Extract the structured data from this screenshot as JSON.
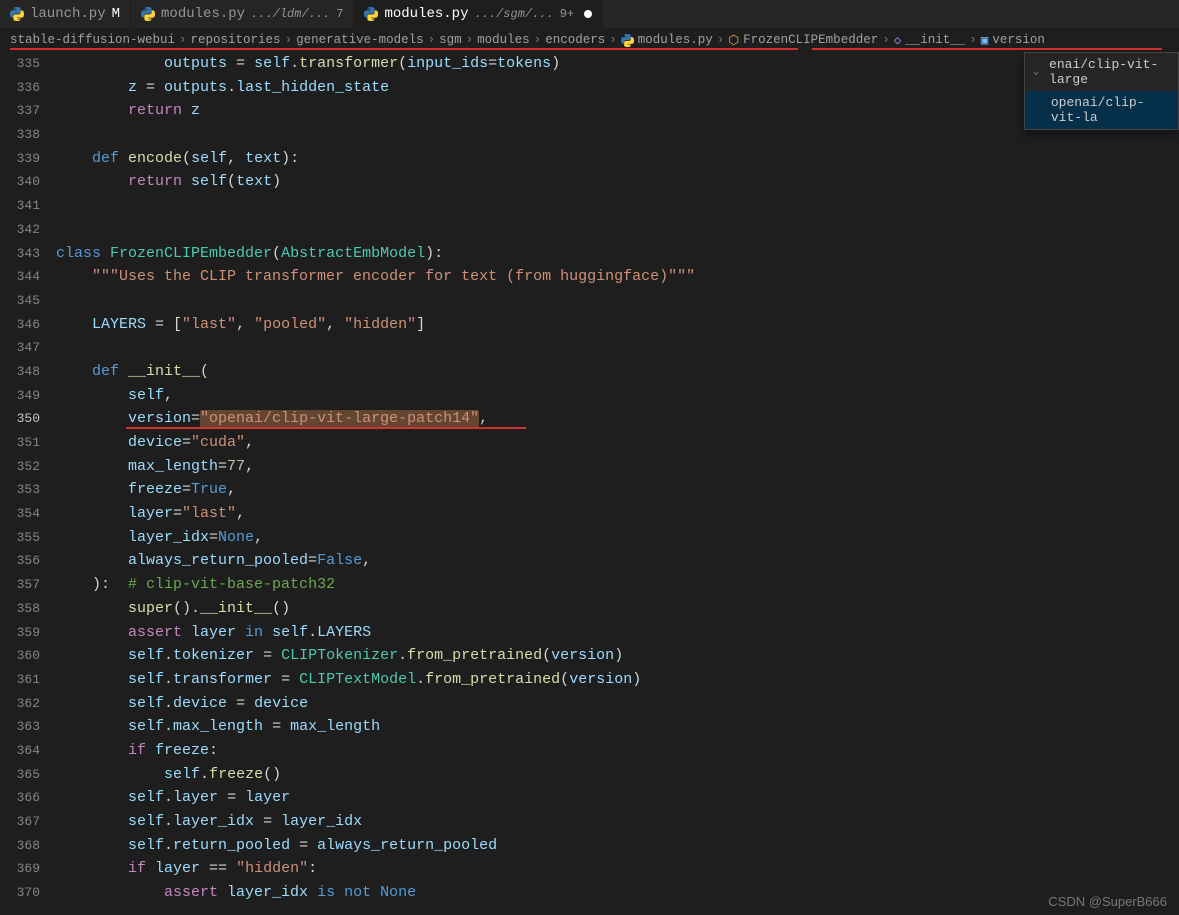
{
  "tabs": [
    {
      "name": "launch.py",
      "modifier": "M",
      "path": ""
    },
    {
      "name": "modules.py",
      "modifier": "7",
      "path": ".../ldm/..."
    },
    {
      "name": "modules.py",
      "modifier": "9+",
      "path": ".../sgm/...",
      "dirty": true
    }
  ],
  "breadcrumb": [
    "stable-diffusion-webui",
    "repositories",
    "generative-models",
    "sgm",
    "modules",
    "encoders",
    "modules.py",
    "FrozenCLIPEmbedder",
    "__init__",
    "version"
  ],
  "dropdown": {
    "line1": "enai/clip-vit-large",
    "line2": "openai/clip-vit-la"
  },
  "lines": {
    "start": 335,
    "end": 370,
    "active": 350
  },
  "code": {
    "335": {
      "outputs": "outputs",
      "eq": " = ",
      "self": "self",
      "dot": ".",
      "transformer": "transformer",
      "lp": "(",
      "input_ids": "input_ids",
      "eq2": "=",
      "tokens": "tokens",
      "rp": ")"
    },
    "336": {
      "z": "z",
      "eq": " = ",
      "outputs": "outputs",
      "dot": ".",
      "last_hidden_state": "last_hidden_state"
    },
    "337": {
      "return": "return",
      "z": " z"
    },
    "339": {
      "def": "def",
      "encode": " encode",
      "lp": "(",
      "self": "self",
      "c": ", ",
      "text": "text",
      "rp": "):"
    },
    "340": {
      "return": "return",
      "self": " self",
      "lp": "(",
      "text": "text",
      "rp": ")"
    },
    "343": {
      "class": "class",
      "name": " FrozenCLIPEmbedder",
      "lp": "(",
      "base": "AbstractEmbModel",
      "rp": "):"
    },
    "344": {
      "doc": "\"\"\"Uses the CLIP transformer encoder for text (from huggingface)\"\"\""
    },
    "346": {
      "layers": "LAYERS",
      "eq": " = [",
      "s1": "\"last\"",
      "c1": ", ",
      "s2": "\"pooled\"",
      "c2": ", ",
      "s3": "\"hidden\"",
      "rb": "]"
    },
    "348": {
      "def": "def",
      "init": " __init__",
      "lp": "("
    },
    "349": {
      "self": "self",
      "c": ","
    },
    "350": {
      "version": "version",
      "eq": "=",
      "val": "\"openai/clip-vit-large-patch14\"",
      "c": ","
    },
    "351": {
      "device": "device",
      "eq": "=",
      "val": "\"cuda\"",
      "c": ","
    },
    "352": {
      "max_length": "max_length",
      "eq": "=",
      "val": "77",
      "c": ","
    },
    "353": {
      "freeze": "freeze",
      "eq": "=",
      "val": "True",
      "c": ","
    },
    "354": {
      "layer": "layer",
      "eq": "=",
      "val": "\"last\"",
      "c": ","
    },
    "355": {
      "layer_idx": "layer_idx",
      "eq": "=",
      "val": "None",
      "c": ","
    },
    "356": {
      "always_return_pooled": "always_return_pooled",
      "eq": "=",
      "val": "False",
      "c": ","
    },
    "357": {
      "rp": "):",
      "com": "  # clip-vit-base-patch32"
    },
    "358": {
      "super": "super",
      "p": "().",
      "init": "__init__",
      "rp": "()"
    },
    "359": {
      "assert": "assert",
      "layer": " layer ",
      "in": "in",
      "self": " self",
      "dot": ".",
      "LAYERS": "LAYERS"
    },
    "360": {
      "self": "self",
      "dot": ".",
      "tok": "tokenizer",
      "eq": " = ",
      "cls": "CLIPTokenizer",
      "dot2": ".",
      "fn": "from_pretrained",
      "lp": "(",
      "ver": "version",
      "rp": ")"
    },
    "361": {
      "self": "self",
      "dot": ".",
      "tr": "transformer",
      "eq": " = ",
      "cls": "CLIPTextModel",
      "dot2": ".",
      "fn": "from_pretrained",
      "lp": "(",
      "ver": "version",
      "rp": ")"
    },
    "362": {
      "self": "self",
      "dot": ".",
      "dev": "device",
      "eq": " = ",
      "v": "device"
    },
    "363": {
      "self": "self",
      "dot": ".",
      "ml": "max_length",
      "eq": " = ",
      "v": "max_length"
    },
    "364": {
      "if": "if",
      "freeze": " freeze",
      "c": ":"
    },
    "365": {
      "self": "self",
      "dot": ".",
      "fn": "freeze",
      "rp": "()"
    },
    "366": {
      "self": "self",
      "dot": ".",
      "layer": "layer",
      "eq": " = ",
      "v": "layer"
    },
    "367": {
      "self": "self",
      "dot": ".",
      "li": "layer_idx",
      "eq": " = ",
      "v": "layer_idx"
    },
    "368": {
      "self": "self",
      "dot": ".",
      "rp": "return_pooled",
      "eq": " = ",
      "v": "always_return_pooled"
    },
    "369": {
      "if": "if",
      "layer": " layer ",
      "eq": "== ",
      "str": "\"hidden\"",
      "c": ":"
    },
    "370": {
      "assert": "assert",
      "li": " layer_idx ",
      "is": "is",
      "not": " not ",
      "none": "None"
    }
  },
  "watermark": "CSDN @SuperB666"
}
